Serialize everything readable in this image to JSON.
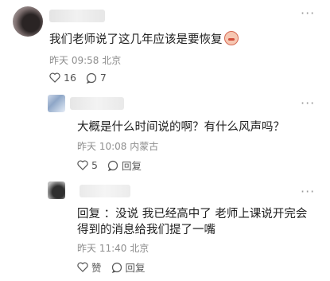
{
  "comments": [
    {
      "text": "我们老师说了这几年应该是要恢复",
      "time": "昨天 09:58",
      "location": "北京",
      "likes": "16",
      "replies": "7"
    },
    {
      "text": "大概是什么时间说的啊？有什么风声吗？",
      "time": "昨天 10:08",
      "location": "内蒙古",
      "likes": "5",
      "reply_label": "回复"
    },
    {
      "text_line1": "回复        ：没说 我已经高中了 老师上课说开完会",
      "text_line2": "得到的消息给我们提了一嘴",
      "time": "昨天 11:40",
      "location": "北京",
      "like_label": "赞",
      "reply_label": "回复"
    }
  ],
  "icons": {
    "like": "heart-outline-icon",
    "reply": "speech-bubble-icon",
    "more": "more-dots-icon",
    "emoji": "face-emoji-icon"
  }
}
